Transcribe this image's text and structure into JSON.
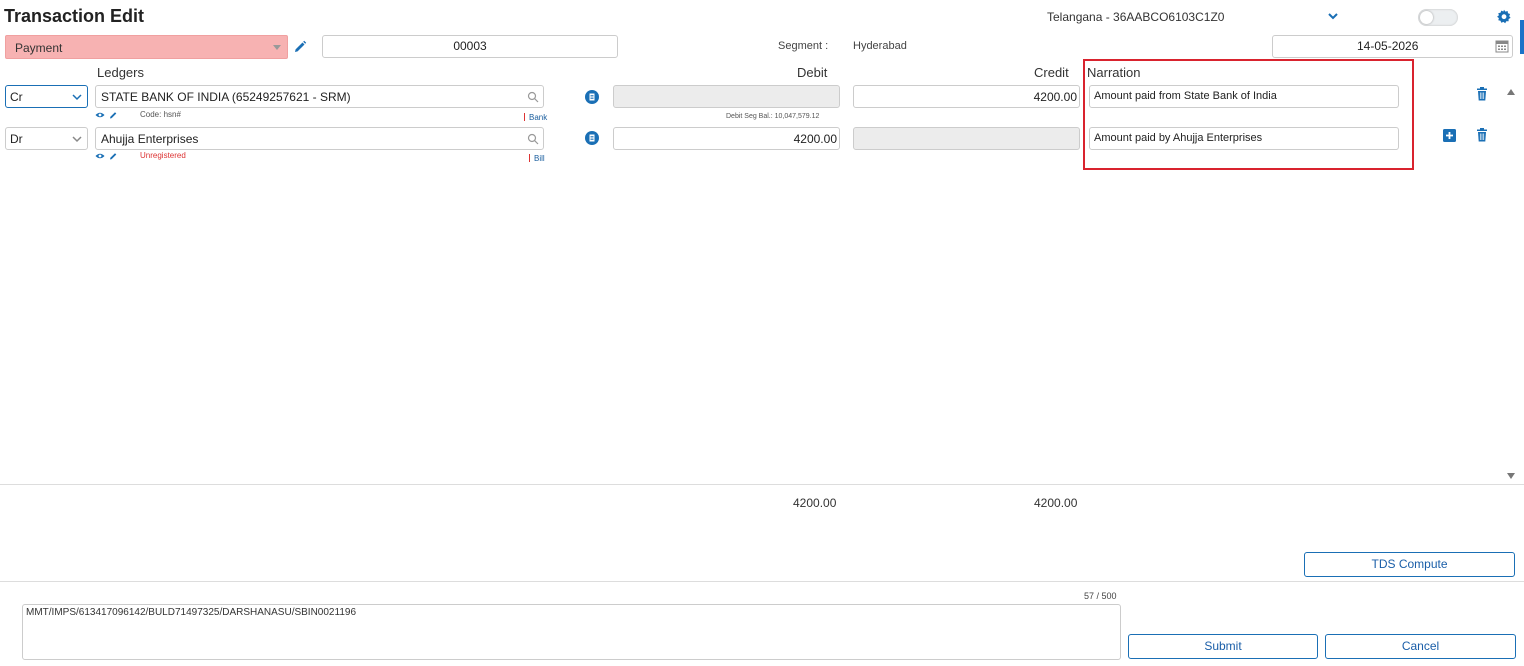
{
  "header": {
    "title": "Transaction Edit",
    "gstin_label": "Telangana - 36AABCO6103C1Z0"
  },
  "form": {
    "voucher_type": "Payment",
    "voucher_number": "00003",
    "segment_label": "Segment :",
    "segment_value": "Hyderabad",
    "date": "14-05-2026"
  },
  "columns": {
    "ledgers": "Ledgers",
    "debit": "Debit",
    "credit": "Credit",
    "narration": "Narration"
  },
  "rows": [
    {
      "crdr": "Cr",
      "ledger": "STATE BANK OF INDIA (65249257621 - SRM)",
      "sub_text": "Code: hsn#",
      "tag": "Bank",
      "debit": "",
      "credit": "4200.00",
      "narration": "Amount paid from State Bank of India",
      "debit_seg_bal": "Debit Seg Bal.: 10,047,579.12"
    },
    {
      "crdr": "Dr",
      "ledger": "Ahujja Enterprises",
      "sub_text": "Unregistered",
      "tag": "Bill",
      "debit": "4200.00",
      "credit": "",
      "narration": "Amount paid by Ahujja Enterprises"
    }
  ],
  "totals": {
    "debit": "4200.00",
    "credit": "4200.00"
  },
  "actions": {
    "tds_compute": "TDS Compute",
    "submit": "Submit",
    "cancel": "Cancel"
  },
  "bank_narration": {
    "counter": "57 / 500",
    "text": "MMT/IMPS/613417096142/BULD71497325/DARSHANASU/SBIN0021196"
  },
  "icons": {
    "accent": "#1a6fb5",
    "payment_bg": "#f7b2b2",
    "highlight": "#d9232e"
  }
}
